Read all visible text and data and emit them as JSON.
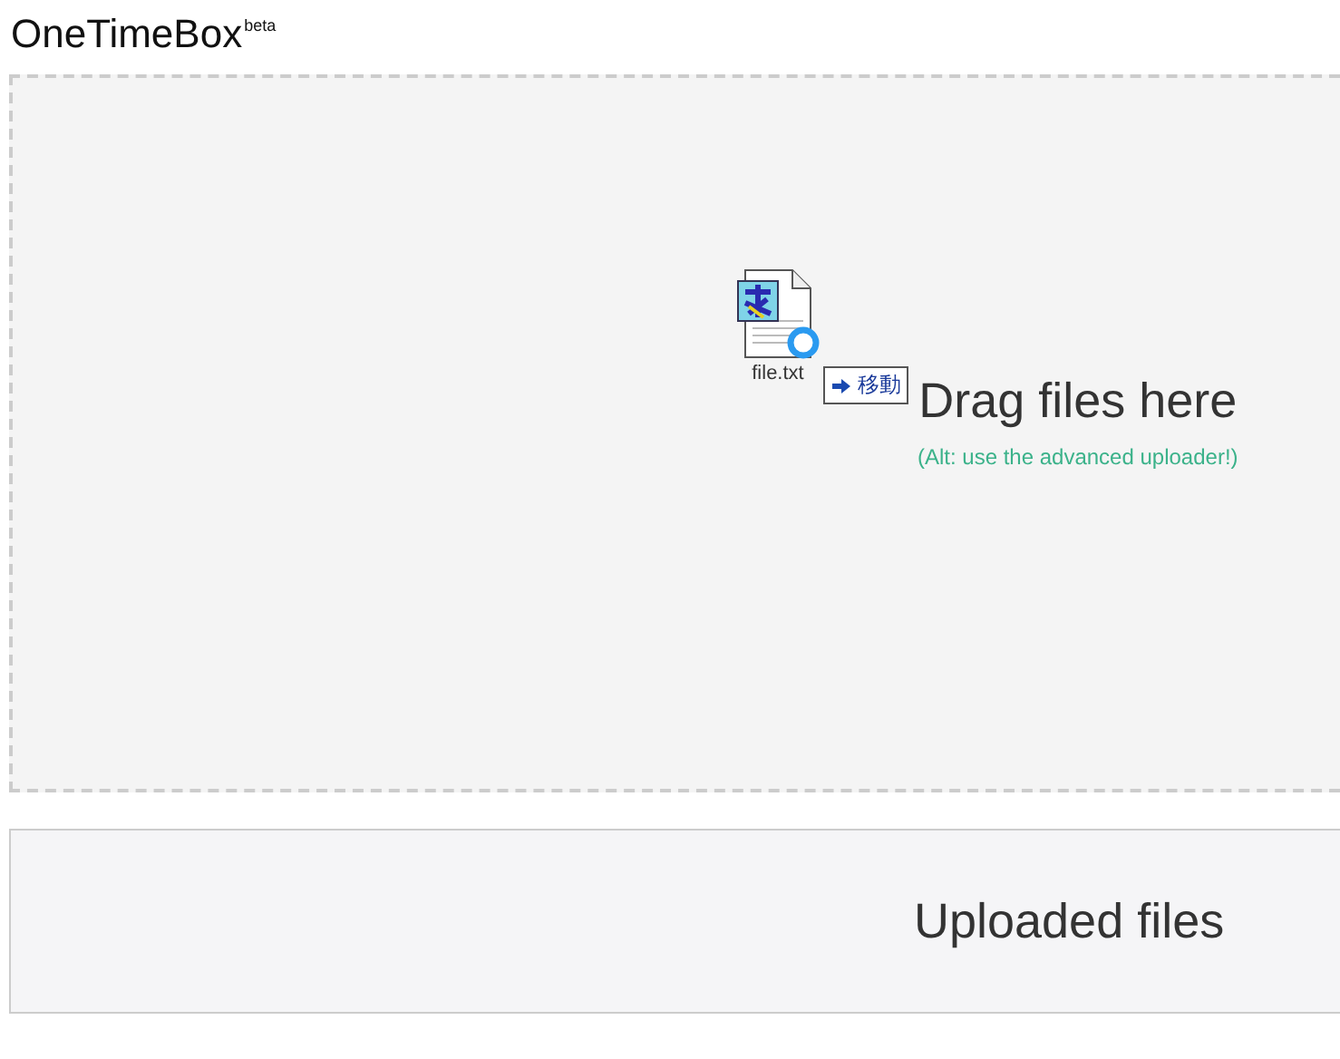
{
  "header": {
    "title": "OneTimeBox",
    "badge": "beta"
  },
  "dropzone": {
    "heading": "Drag files here",
    "hint": "(Alt: use the advanced uploader!)"
  },
  "drag_ghost": {
    "filename": "file.txt",
    "action": "移動"
  },
  "uploaded": {
    "heading": "Uploaded files"
  }
}
